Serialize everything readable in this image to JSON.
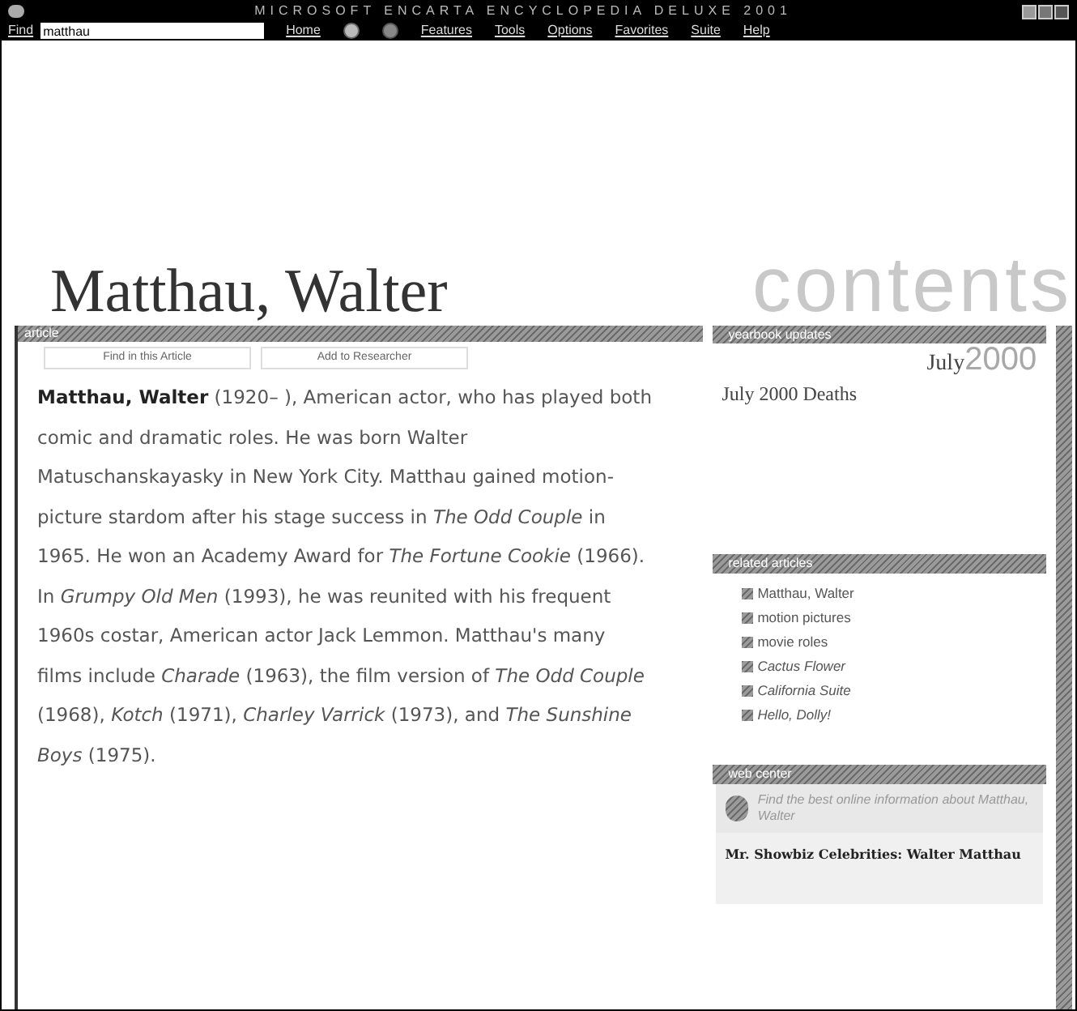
{
  "window": {
    "title": "MICROSOFT ENCARTA ENCYCLOPEDIA DELUXE 2001"
  },
  "menu_bar": {
    "find_label": "Find",
    "find_value": "matthau",
    "items": [
      {
        "kind": "text",
        "label": "Home"
      },
      {
        "kind": "back"
      },
      {
        "kind": "forward"
      },
      {
        "kind": "text",
        "label": "Features"
      },
      {
        "kind": "text",
        "label": "Tools"
      },
      {
        "kind": "text",
        "label": "Options"
      },
      {
        "kind": "text",
        "label": "Favorites"
      },
      {
        "kind": "text",
        "label": "Suite"
      },
      {
        "kind": "text",
        "label": "Help"
      }
    ]
  },
  "heading": {
    "title": "Matthau, Walter",
    "backdrop": "contents"
  },
  "article": {
    "header": "article",
    "buttons": [
      "Find in this Article",
      "Add to Researcher"
    ],
    "text": "**Matthau, Walter** (1920– ), American actor, who has played both comic and dramatic roles. He was born Walter Matuschanskayasky in New York City. Matthau gained motion-picture stardom after his stage success in *The Odd Couple* in 1965. He won an Academy Award for *The Fortune Cookie* (1966). In *Grumpy Old Men* (1993), he was reunited with his frequent 1960s costar, American actor Jack Lemmon. Matthau's many films include *Charade* (1963), the film version of *The Odd Couple* (1968), *Kotch* (1971), *Charley Varrick* (1973), and *The Sunshine Boys* (1975)."
  },
  "yearbook": {
    "header": "yearbook updates",
    "month": "July",
    "year": "2000",
    "link": "July 2000 Deaths"
  },
  "related": {
    "header": "related articles",
    "items": [
      {
        "kind": "topic",
        "label": "Matthau, Walter"
      },
      {
        "kind": "topic",
        "label": "motion pictures"
      },
      {
        "kind": "topic",
        "label": "movie roles"
      },
      {
        "kind": "work",
        "label": "Cactus Flower"
      },
      {
        "kind": "work",
        "label": "California Suite"
      },
      {
        "kind": "work",
        "label": "Hello, Dolly!"
      }
    ]
  },
  "web_center": {
    "header": "web center",
    "promo": "Find the best online information about Matthau, Walter",
    "link": "Mr. Showbiz Celebrities: Walter Matthau"
  }
}
